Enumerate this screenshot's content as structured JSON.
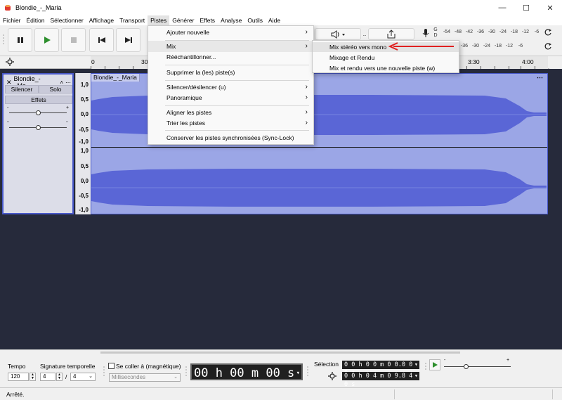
{
  "window": {
    "title": "Blondie_-_Maria",
    "minimize": "—",
    "maximize": "☐",
    "close": "✕"
  },
  "menubar": {
    "items": [
      "Fichier",
      "Édition",
      "Sélectionner",
      "Affichage",
      "Transport",
      "Pistes",
      "Générer",
      "Effets",
      "Analyse",
      "Outils",
      "Aide"
    ],
    "active_index": 5
  },
  "toolbar": {
    "buttons": [
      "pause-icon",
      "play-icon",
      "stop-icon",
      "skip-to-start-icon",
      "skip-to-end-icon"
    ],
    "meter_scale": [
      "-54",
      "-48",
      "-42",
      "-36",
      "-30",
      "-24",
      "-18",
      "-12",
      "-6"
    ],
    "meter_channels": [
      "G",
      "D"
    ]
  },
  "ruler": {
    "ticks": [
      "0",
      "30",
      "3:30",
      "4:00"
    ]
  },
  "track": {
    "name": "Blondie_-_Ma...",
    "wave_label": "Blondie_-_Maria",
    "mute_label": "Silencer",
    "solo_label": "Solo",
    "effects_label": "Effets",
    "gain_minus": "-",
    "gain_plus": "+",
    "pan_left": "G",
    "pan_right": "D",
    "scale_labels": [
      "1,0",
      "0,5",
      "0,0",
      "-0,5",
      "-1,0",
      "1,0",
      "0,5",
      "0,0",
      "-0,5",
      "-1,0"
    ]
  },
  "pistes_menu": {
    "items": [
      {
        "label": "Ajouter nouvelle",
        "submenu": true
      },
      {
        "label": "Mix",
        "submenu": true,
        "highlight": true
      },
      {
        "label": "Rééchantillonner...",
        "submenu": false
      },
      {
        "label": "Supprimer la (les) piste(s)",
        "submenu": false
      },
      {
        "label": "Silencer/désilencer (u)",
        "submenu": true
      },
      {
        "label": "Panoramique",
        "submenu": true
      },
      {
        "label": "Aligner les pistes",
        "submenu": true
      },
      {
        "label": "Trier les pistes",
        "submenu": true
      },
      {
        "label": "Conserver les pistes synchronisées (Sync-Lock)",
        "submenu": false
      }
    ]
  },
  "mix_submenu": {
    "items": [
      {
        "label": "Mix stéréo vers mono",
        "highlight": true
      },
      {
        "label": "Mixage et Rendu",
        "highlight": false
      },
      {
        "label": "Mix et rendu vers une nouvelle piste (w)",
        "highlight": false
      }
    ]
  },
  "bottom": {
    "tempo_label": "Tempo",
    "tempo_value": "120",
    "signature_label": "Signature temporelle",
    "sig_numerator": "4",
    "sig_slash": "/",
    "sig_denominator": "4",
    "snap_label": "Se coller à (magnétique)",
    "snap_unit": "Millisecondes",
    "time_display": "00 h 00 m 00 s",
    "selection_label": "Sélection",
    "selection_start": "0 0 h 0 0 m 0 0.0 0 0 s",
    "selection_end": "0 0 h 0 4 m 0 9.8 4 0 s",
    "playback_minus": "-",
    "playback_plus": "+"
  },
  "status": {
    "text": "Arrêté."
  },
  "colors": {
    "waveform": "#5a66d6",
    "waveform_bg": "#9ba6e6",
    "arrow": "#e02020",
    "track_bg": "#262a3b"
  }
}
